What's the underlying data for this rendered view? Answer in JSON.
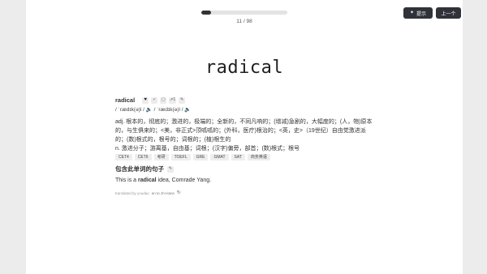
{
  "progress": {
    "fraction": 0.11,
    "label": "11 / 98"
  },
  "buttons": {
    "hint_label": "提示",
    "hint_icon": "sparkle-icon",
    "prev_label": "上一个"
  },
  "word": "radical",
  "entry": {
    "headword": "radical",
    "actions": [
      {
        "name": "heart-icon",
        "glyph": "♥"
      },
      {
        "name": "check-icon",
        "glyph": "✓"
      },
      {
        "name": "bookmark-icon",
        "glyph": "▢"
      },
      {
        "name": "link-count",
        "glyph": "⇗1"
      },
      {
        "name": "edit-icon",
        "glyph": "✎"
      }
    ],
    "phonetic": "/ ˈrædɪk(ə)l / 🔈 / ˈrædɪk(ə)l / 🔈",
    "definitions": [
      "adj. 根本的，彻底的；激进的，极端的；全新的，不同凡响的；(增减)急剧的，大幅度的；(人，物)原本的，与生俱来的；<美，非正式>顶呱呱的；(外科，医疗)根治的；<英，史>（19世纪）自由党激进派的；(数)根式的，根号的；词根的；(植)根生的",
      "n. 激进分子；游离基，自由基；词根；(汉字)偏旁，部首；(数)根式；根号"
    ],
    "tags": [
      "CET4",
      "CET6",
      "考研",
      "TOEFL",
      "GRE",
      "GMAT",
      "SAT",
      "商务英语"
    ]
  },
  "sentence_section": {
    "title": "包含此单词的句子",
    "before": "This is a ",
    "highlight": "radical",
    "after": " idea, Comrade Yang."
  },
  "credit": {
    "prefix": "translated by youdao",
    "lang": "en to zh-Hans",
    "icon": "refresh-icon"
  }
}
